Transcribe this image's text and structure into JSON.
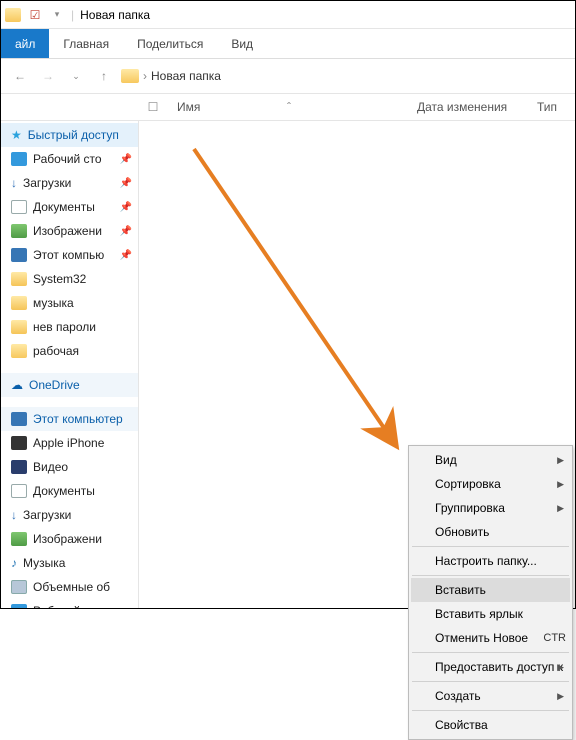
{
  "titlebar": {
    "title": "Новая папка"
  },
  "ribbon": {
    "file": "айл",
    "home": "Главная",
    "share": "Поделиться",
    "view": "Вид"
  },
  "breadcrumb": {
    "folder": "Новая папка",
    "sep": "›"
  },
  "columns": {
    "name": "Имя",
    "date": "Дата изменения",
    "type": "Тип"
  },
  "sidebar": {
    "quick": "Быстрый доступ",
    "items1": [
      {
        "label": "Рабочий сто",
        "ico": "ico-desktop",
        "pin": true
      },
      {
        "label": "Загрузки",
        "ico": "ico-down",
        "pin": true
      },
      {
        "label": "Документы",
        "ico": "ico-doc",
        "pin": true
      },
      {
        "label": "Изображени",
        "ico": "ico-img",
        "pin": true
      },
      {
        "label": "Этот компью",
        "ico": "ico-pc",
        "pin": true
      },
      {
        "label": "System32",
        "ico": "ico-folder",
        "pin": false
      },
      {
        "label": "музыка",
        "ico": "ico-folder",
        "pin": false
      },
      {
        "label": "нев пароли",
        "ico": "ico-folder",
        "pin": false
      },
      {
        "label": "рабочая",
        "ico": "ico-folder-o",
        "pin": false
      }
    ],
    "onedrive": "OneDrive",
    "thispc": "Этот компьютер",
    "items2": [
      {
        "label": "Apple iPhone",
        "ico": "ico-phone"
      },
      {
        "label": "Видео",
        "ico": "ico-video"
      },
      {
        "label": "Документы",
        "ico": "ico-doc"
      },
      {
        "label": "Загрузки",
        "ico": "ico-down"
      },
      {
        "label": "Изображени",
        "ico": "ico-img"
      },
      {
        "label": "Музыка",
        "ico": "ico-music"
      },
      {
        "label": "Объемные об",
        "ico": "ico-drive"
      },
      {
        "label": "Рабочий сто",
        "ico": "ico-desktop"
      }
    ]
  },
  "context_menu": {
    "view": "Вид",
    "sort": "Сортировка",
    "group": "Группировка",
    "refresh": "Обновить",
    "customize": "Настроить папку...",
    "paste": "Вставить",
    "paste_shortcut": "Вставить ярлык",
    "undo": "Отменить Новое",
    "undo_key": "CTR",
    "share": "Предоставить доступ к",
    "new": "Создать",
    "properties": "Свойства"
  }
}
